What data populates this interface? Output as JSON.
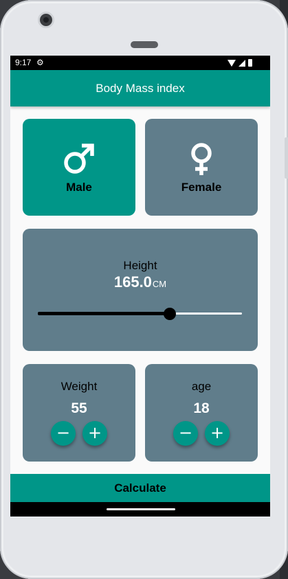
{
  "statusbar": {
    "time": "9:17"
  },
  "appbar": {
    "title": "Body Mass index"
  },
  "gender": {
    "male": {
      "label": "Male",
      "selected": true
    },
    "female": {
      "label": "Female",
      "selected": false
    }
  },
  "height": {
    "label": "Height",
    "value": "165.0",
    "unit": "CM",
    "slider_fraction": 0.647
  },
  "weight": {
    "label": "Weight",
    "value": "55"
  },
  "age": {
    "label": "age",
    "value": "18"
  },
  "buttons": {
    "minus": "−",
    "plus": "+"
  },
  "calculate": {
    "label": "Calculate"
  },
  "colors": {
    "primary": "#009688",
    "card": "#607d8b",
    "value_text": "#ffffff"
  }
}
